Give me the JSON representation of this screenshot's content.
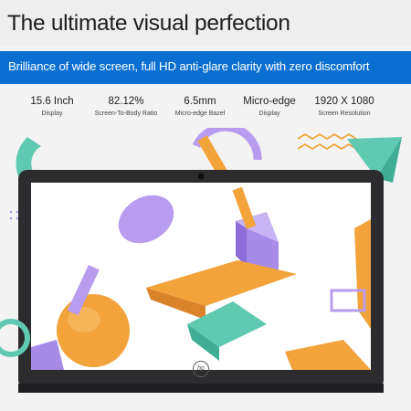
{
  "headline": "The ultimate visual perfection",
  "banner": "Brilliance of wide screen, full HD anti-glare clarity with zero discomfort",
  "specs": [
    {
      "value": "15.6 Inch",
      "label": "Display"
    },
    {
      "value": "82.12%",
      "label": "Screen-To-Body Ratio"
    },
    {
      "value": "6.5mm",
      "label": "Micro-edge Bazel"
    },
    {
      "value": "Micro-edge",
      "label": "Display"
    },
    {
      "value": "1920 X 1080",
      "label": "Screen Resolution"
    }
  ],
  "logo_text": "hp",
  "colors": {
    "banner": "#0a6fd0",
    "laptop_bezel": "#2c2c2e",
    "shape_orange": "#f2a33a",
    "shape_purple": "#b89cef",
    "shape_teal": "#5fcab1"
  }
}
